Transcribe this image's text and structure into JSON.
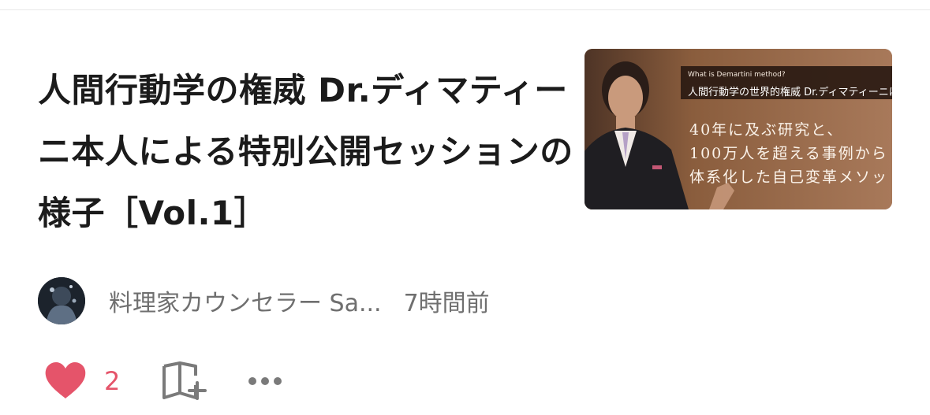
{
  "article": {
    "title": "人間行動学の権威 Dr.ディマティーニ本人による特別公開セッションの様子［Vol.1］",
    "thumbnail": {
      "caption_en": "What is Demartini method?",
      "caption_jp": "人間行動学の世界的権威 Dr.ディマティーニによ",
      "lines": [
        "40年に及ぶ研究と、",
        "100万人を超える事例から",
        "体系化した自己変革メソッ"
      ]
    }
  },
  "meta": {
    "author": "料理家カウンセラー Sa...",
    "time": "7時間前"
  },
  "actions": {
    "like_count": "2",
    "like_icon": "heart-icon",
    "magazine_icon": "add-to-magazine-icon",
    "more_icon": "more-icon"
  },
  "colors": {
    "like": "#e5546a",
    "text": "#1b1b1b",
    "muted": "#6f6f6f"
  }
}
